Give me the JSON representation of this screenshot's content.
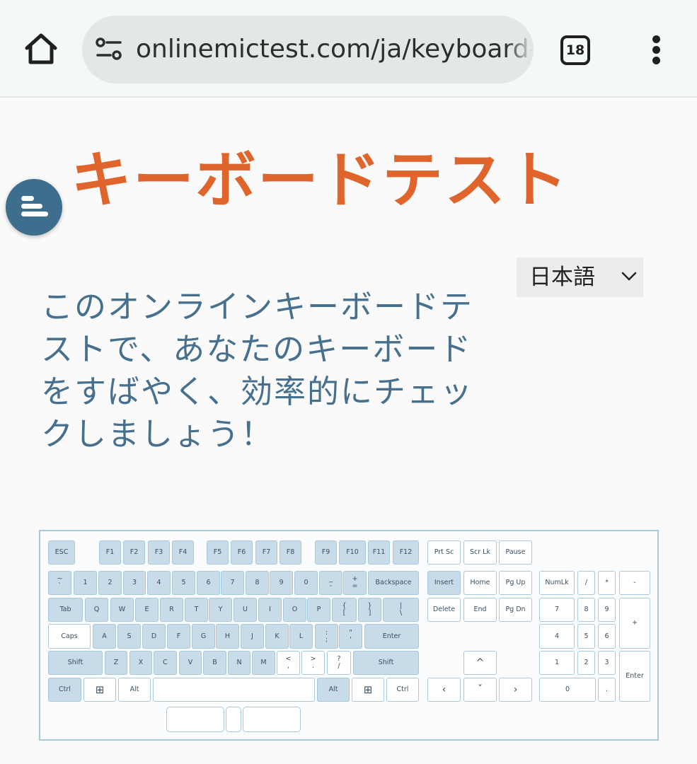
{
  "browser": {
    "url": "onlinemictest.com/ja/keyboard-test/",
    "tab_count": "18"
  },
  "page": {
    "title": "キーボードテスト",
    "language": "日本語",
    "intro": "このオンラインキーボードテストで、あなたのキーボードをすばやく、効率的にチェックしましょう！"
  },
  "keyboard": {
    "keys": [
      {
        "label": "ESC",
        "active": true
      },
      {
        "label": "F1",
        "active": true
      },
      {
        "label": "F2",
        "active": true
      },
      {
        "label": "F3",
        "active": true
      },
      {
        "label": "F4",
        "active": true
      },
      {
        "label": "F5",
        "active": true
      },
      {
        "label": "F6",
        "active": true
      },
      {
        "label": "F7",
        "active": true
      },
      {
        "label": "F8",
        "active": true
      },
      {
        "label": "F9",
        "active": true
      },
      {
        "label": "F10",
        "active": true
      },
      {
        "label": "F11",
        "active": true
      },
      {
        "label": "F12",
        "active": true
      },
      {
        "label": "Prt Sc",
        "active": false
      },
      {
        "label": "Scr Lk",
        "active": false
      },
      {
        "label": "Pause",
        "active": false
      },
      {
        "label": "~\n`",
        "active": true
      },
      {
        "label": "1",
        "active": true
      },
      {
        "label": "2",
        "active": true
      },
      {
        "label": "3",
        "active": true
      },
      {
        "label": "4",
        "active": true
      },
      {
        "label": "5",
        "active": true
      },
      {
        "label": "6",
        "active": true
      },
      {
        "label": "7",
        "active": true
      },
      {
        "label": "8",
        "active": true
      },
      {
        "label": "9",
        "active": true
      },
      {
        "label": "0",
        "active": true
      },
      {
        "label": "_\n-",
        "active": true
      },
      {
        "label": "+\n=",
        "active": true
      },
      {
        "label": "Backspace",
        "active": true
      },
      {
        "label": "Insert",
        "active": true
      },
      {
        "label": "Home",
        "active": false
      },
      {
        "label": "Pg Up",
        "active": false
      },
      {
        "label": "NumLk",
        "active": false
      },
      {
        "label": "/",
        "active": false
      },
      {
        "label": "*",
        "active": false
      },
      {
        "label": "-",
        "active": false
      },
      {
        "label": "Tab",
        "active": true
      },
      {
        "label": "Q",
        "active": true
      },
      {
        "label": "W",
        "active": true
      },
      {
        "label": "E",
        "active": true
      },
      {
        "label": "R",
        "active": true
      },
      {
        "label": "T",
        "active": true
      },
      {
        "label": "Y",
        "active": true
      },
      {
        "label": "U",
        "active": true
      },
      {
        "label": "I",
        "active": true
      },
      {
        "label": "O",
        "active": true
      },
      {
        "label": "P",
        "active": true
      },
      {
        "label": "{\n[",
        "active": true
      },
      {
        "label": "}\n]",
        "active": true
      },
      {
        "label": "|\n\\",
        "active": true
      },
      {
        "label": "Delete",
        "active": false
      },
      {
        "label": "End",
        "active": false
      },
      {
        "label": "Pg Dn",
        "active": false
      },
      {
        "label": "7",
        "active": false
      },
      {
        "label": "8",
        "active": false
      },
      {
        "label": "9",
        "active": false
      },
      {
        "label": "+",
        "active": false
      },
      {
        "label": "Caps",
        "active": false
      },
      {
        "label": "A",
        "active": true
      },
      {
        "label": "S",
        "active": true
      },
      {
        "label": "D",
        "active": true
      },
      {
        "label": "F",
        "active": true
      },
      {
        "label": "G",
        "active": true
      },
      {
        "label": "H",
        "active": true
      },
      {
        "label": "J",
        "active": true
      },
      {
        "label": "K",
        "active": true
      },
      {
        "label": "L",
        "active": true
      },
      {
        "label": ":\n;",
        "active": true
      },
      {
        "label": "\"\n'",
        "active": true
      },
      {
        "label": "Enter",
        "active": true
      },
      {
        "label": "4",
        "active": false
      },
      {
        "label": "5",
        "active": false
      },
      {
        "label": "6",
        "active": false
      },
      {
        "label": "Shift",
        "active": true
      },
      {
        "label": "Z",
        "active": true
      },
      {
        "label": "X",
        "active": true
      },
      {
        "label": "C",
        "active": true
      },
      {
        "label": "V",
        "active": true
      },
      {
        "label": "B",
        "active": true
      },
      {
        "label": "N",
        "active": true
      },
      {
        "label": "M",
        "active": true
      },
      {
        "label": "<\n,",
        "active": false
      },
      {
        "label": ">\n.",
        "active": false
      },
      {
        "label": "?\n/",
        "active": false
      },
      {
        "label": "Shift",
        "active": true
      },
      {
        "label": "^",
        "active": false
      },
      {
        "label": "1",
        "active": false
      },
      {
        "label": "2",
        "active": false
      },
      {
        "label": "3",
        "active": false
      },
      {
        "label": "Enter",
        "active": false
      },
      {
        "label": "Ctrl",
        "active": true
      },
      {
        "label": "⊞",
        "active": false
      },
      {
        "label": "Alt",
        "active": false
      },
      {
        "label": "",
        "active": false
      },
      {
        "label": "Alt",
        "active": true
      },
      {
        "label": "⊞",
        "active": false
      },
      {
        "label": "Ctrl",
        "active": false
      },
      {
        "label": "‹",
        "active": false
      },
      {
        "label": "ˇ",
        "active": false
      },
      {
        "label": "›",
        "active": false
      },
      {
        "label": "0",
        "active": false
      },
      {
        "label": ".",
        "active": false
      }
    ]
  }
}
